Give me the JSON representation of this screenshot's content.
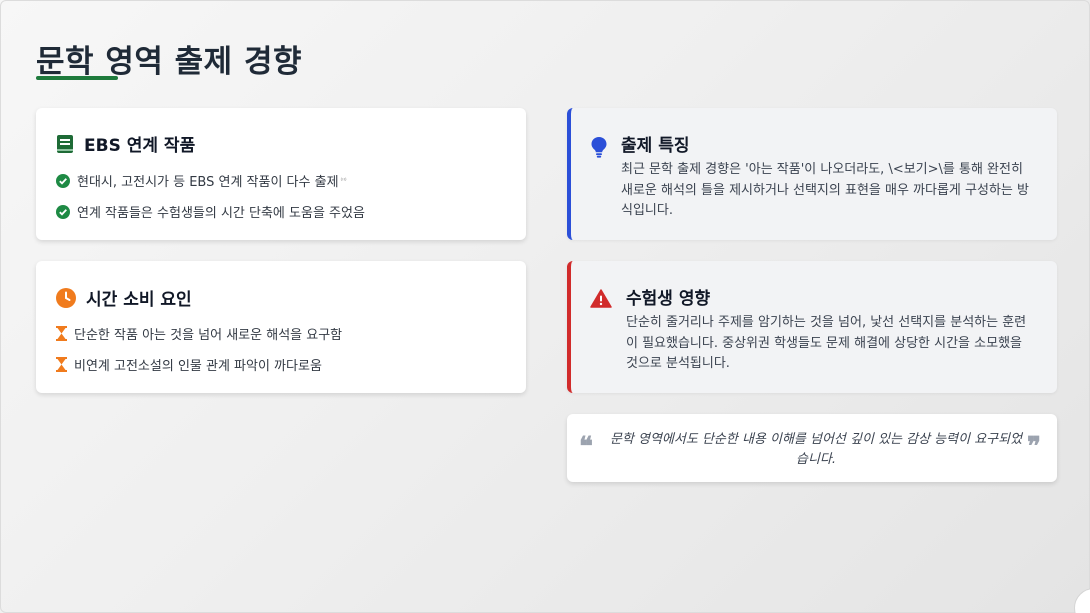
{
  "page": {
    "title": "문학 영역 출제 경향",
    "accent_color": "#1e7a3c"
  },
  "ebs_card": {
    "title": "EBS 연계 작품",
    "icon": "book-icon",
    "items": [
      {
        "icon": "check-circle-icon",
        "text": "현대시, 고전시가 등 EBS 연계 작품이 다수 출제",
        "note": "⁽ᴵᴵ⁾"
      },
      {
        "icon": "check-circle-icon",
        "text": "연계 작품들은 수험생들의 시간 단축에 도움을 주었음"
      }
    ]
  },
  "time_card": {
    "title": "시간 소비 요인",
    "icon": "clock-icon",
    "items": [
      {
        "icon": "hourglass-icon",
        "text": "단순한 작품 아는 것을 넘어 새로운 해석을 요구함"
      },
      {
        "icon": "hourglass-icon",
        "text": "비연계 고전소설의 인물 관계 파악이 까다로움"
      }
    ]
  },
  "feature_card": {
    "title": "출제 특징",
    "icon": "lightbulb-icon",
    "accent": "#2b4fd8",
    "text": "최근 문학 출제 경향은 '아는 작품'이 나오더라도, \\<보기>\\를 통해 완전히 새로운 해석의 틀을 제시하거나 선택지의 표현을 매우 까다롭게 구성하는 방식입니다."
  },
  "impact_card": {
    "title": "수험생 영향",
    "icon": "warning-icon",
    "accent": "#d12b2b",
    "text": "단순히 줄거리나 주제를 암기하는 것을 넘어, 낯선 선택지를 분석하는 훈련이 필요했습니다. 중상위권 학생들도 문제 해결에 상당한 시간을 소모했을 것으로 분석됩니다."
  },
  "quote_card": {
    "text": "문학 영역에서도 단순한 내용 이해를 넘어선 깊이 있는 감상 능력이 요구되었습니다.",
    "open_mark": "❝",
    "close_mark": "❞"
  }
}
